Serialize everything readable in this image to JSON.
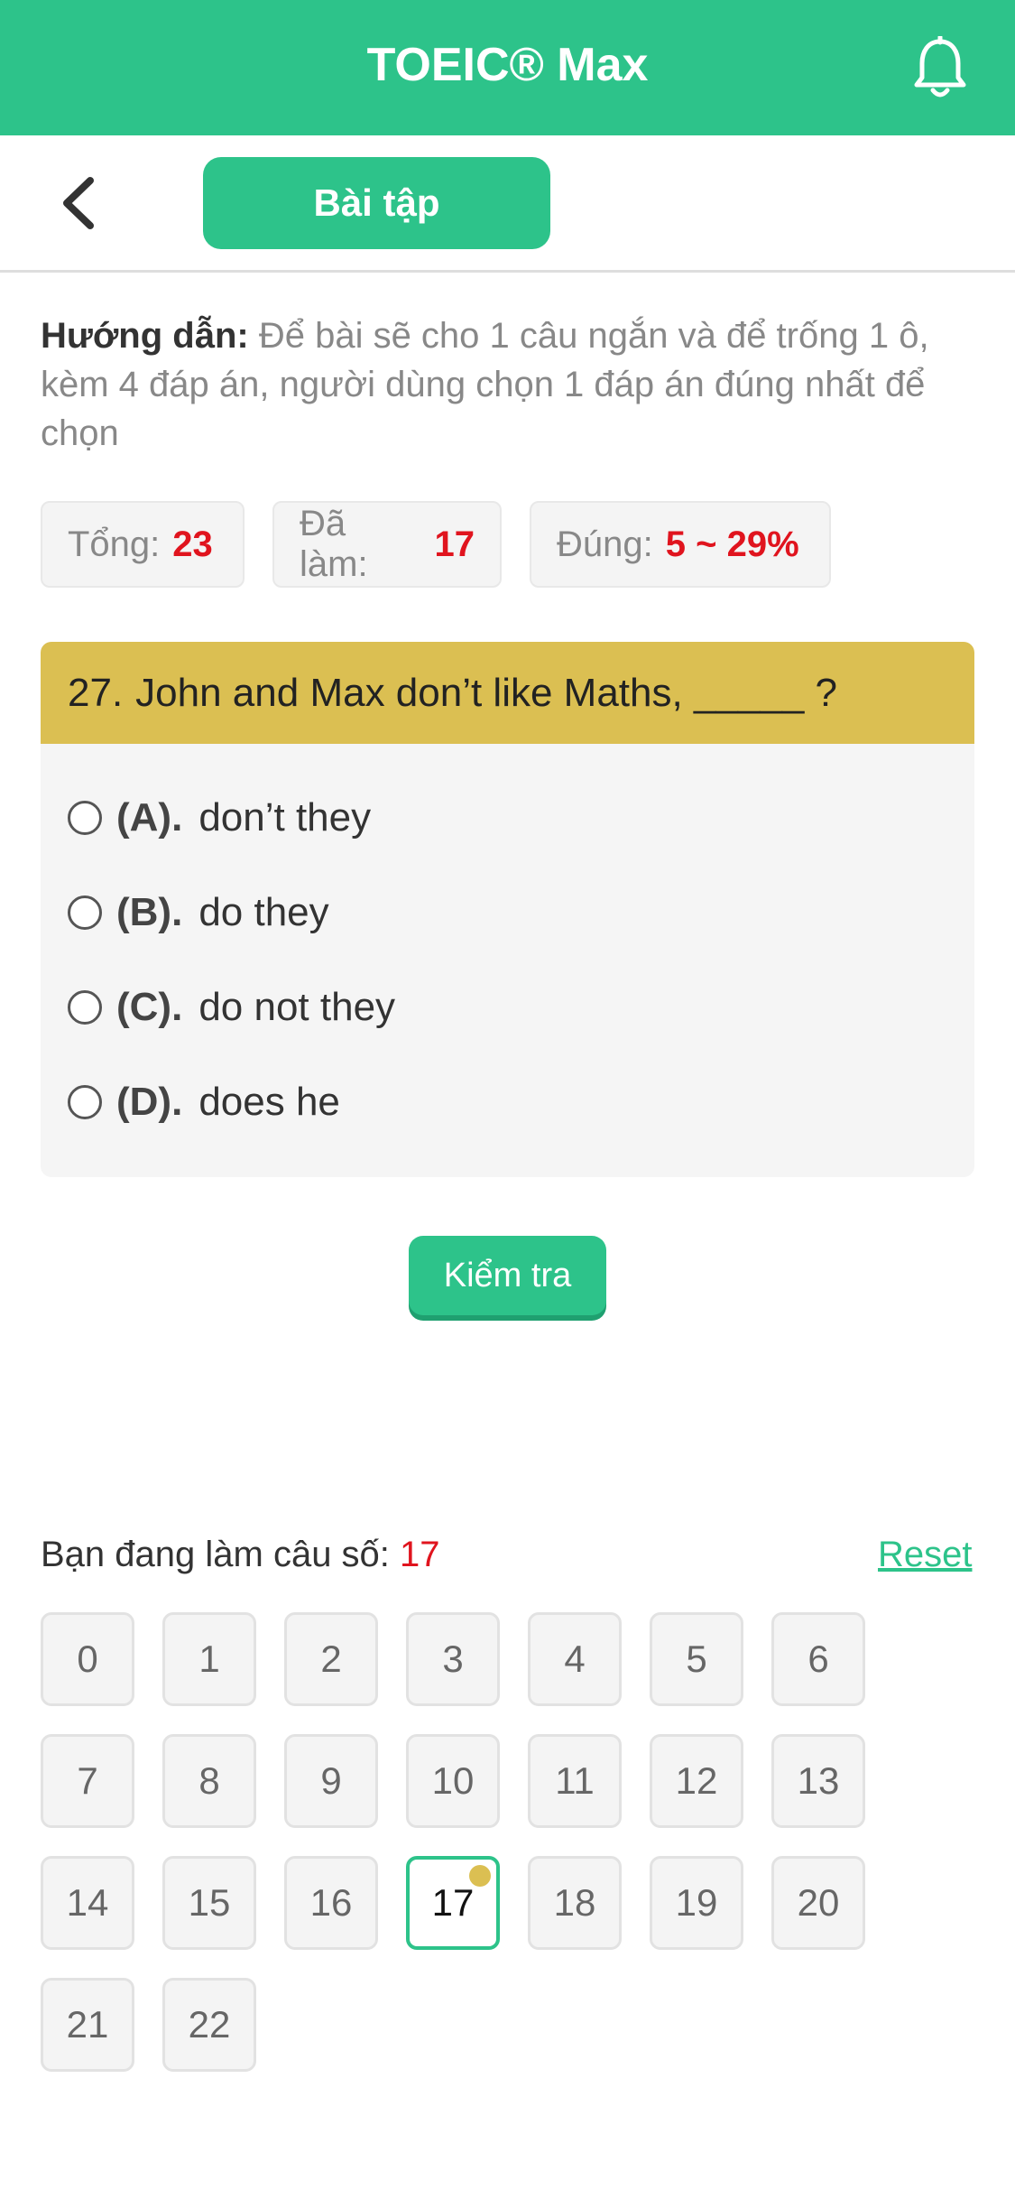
{
  "header": {
    "title": "TOEIC® Max",
    "bell_icon": "bell-icon"
  },
  "subbar": {
    "back_icon": "chevron-left-icon",
    "tab_label": "Bài tập"
  },
  "guide": {
    "label": "Hướng dẫn:",
    "text": "Để bài sẽ cho 1 câu ngắn và để trống 1 ô, kèm 4 đáp án, người dùng chọn 1 đáp án đúng nhất để chọn"
  },
  "stats": {
    "total_label": "Tổng:",
    "total_value": "23",
    "done_label": "Đã làm:",
    "done_value": "17",
    "correct_label": "Đúng:",
    "correct_value": "5 ~ 29%"
  },
  "question": {
    "number": "27.",
    "text": "John and Max don’t like Maths, _____ ?",
    "options": [
      {
        "letter": "(A).",
        "text": "don’t they"
      },
      {
        "letter": "(B).",
        "text": "do they"
      },
      {
        "letter": "(C).",
        "text": "do not they"
      },
      {
        "letter": "(D).",
        "text": "does he"
      }
    ]
  },
  "check_button": "Kiểm tra",
  "progress": {
    "label": "Bạn đang làm câu số:",
    "current": "17",
    "reset_label": "Reset"
  },
  "question_numbers": [
    "0",
    "1",
    "2",
    "3",
    "4",
    "5",
    "6",
    "7",
    "8",
    "9",
    "10",
    "11",
    "12",
    "13",
    "14",
    "15",
    "16",
    "17",
    "18",
    "19",
    "20",
    "21",
    "22"
  ],
  "colors": {
    "accent": "#2dc38a",
    "question_header": "#dbbf52",
    "highlight": "#e0141e"
  }
}
